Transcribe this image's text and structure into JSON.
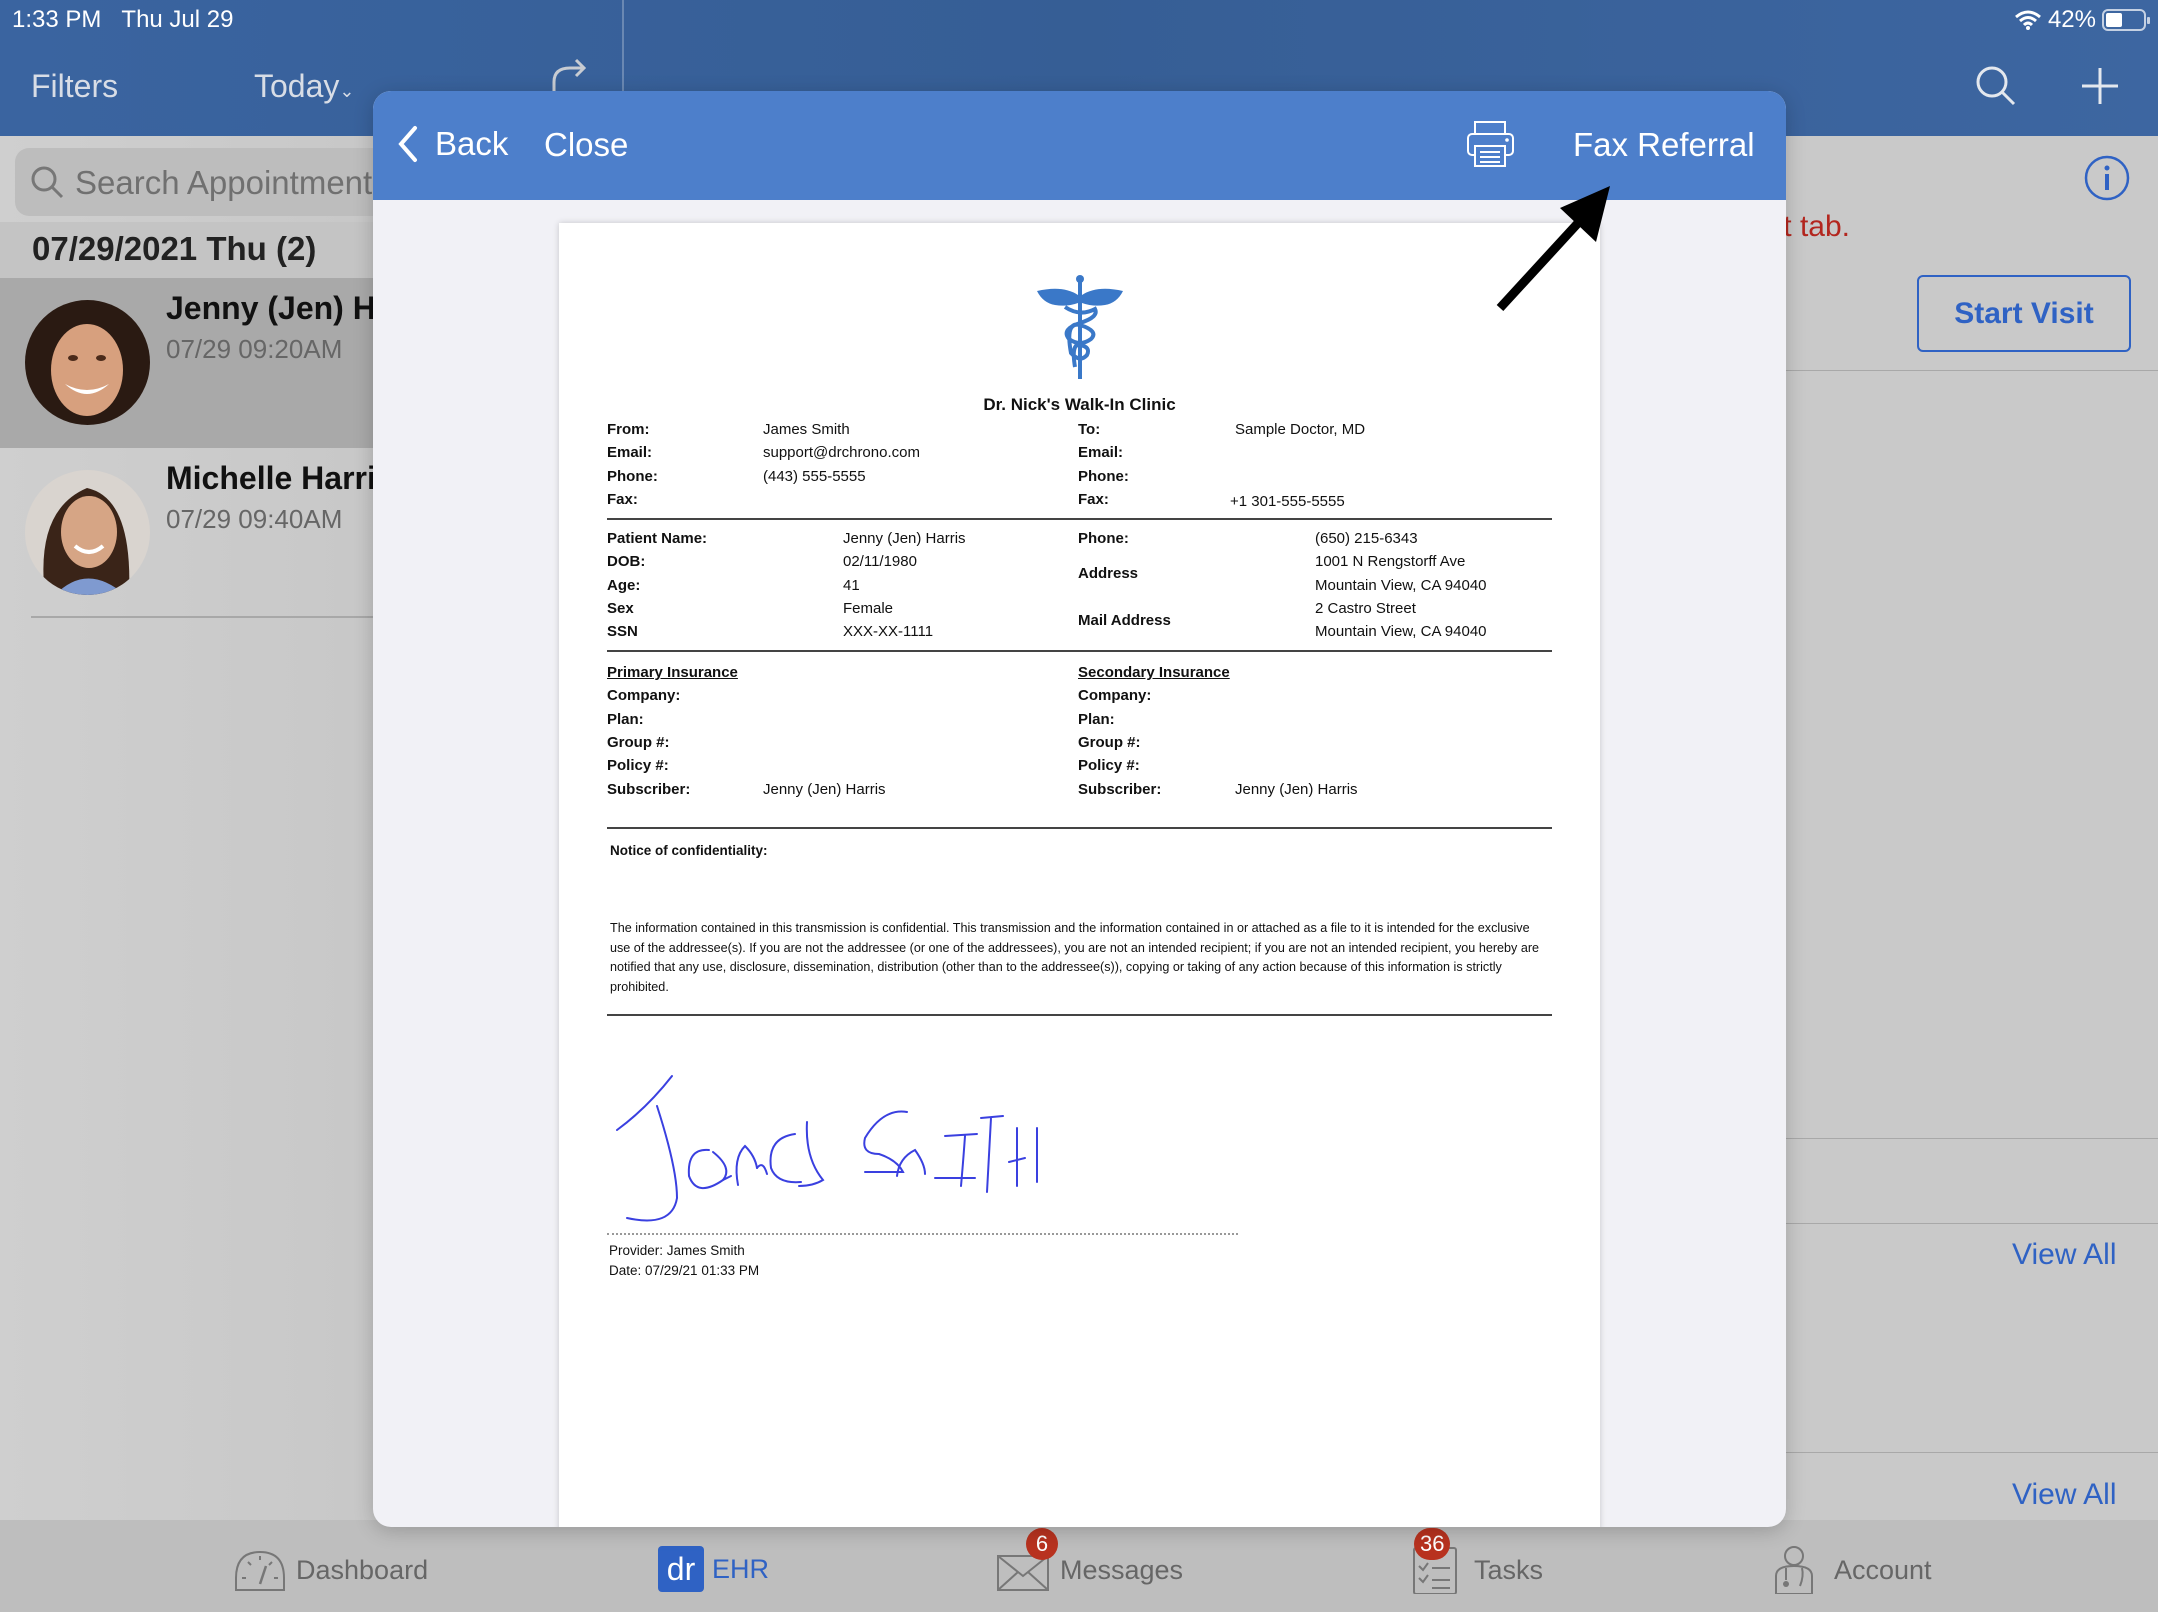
{
  "status_bar": {
    "time": "1:33 PM",
    "date": "Thu Jul 29",
    "battery_percent": "42%",
    "battery_level": 0.42,
    "wifi_icon": "wifi-icon"
  },
  "nav": {
    "filters_label": "Filters",
    "today_label": "Today",
    "today_chevron": "⌄",
    "refresh_icon": "refresh-icon",
    "search_icon": "search-icon",
    "add_icon": "plus-icon"
  },
  "sidebar": {
    "search_placeholder": "Search Appointments",
    "date_header": "07/29/2021 Thu (2)",
    "appointments": [
      {
        "name": "Jenny (Jen) Harris",
        "time": "07/29 09:20AM",
        "selected": true
      },
      {
        "name": "Michelle Harris",
        "time": "07/29 09:40AM",
        "selected": false
      }
    ]
  },
  "right_panel": {
    "info_icon": "info-icon",
    "warning_text": "t tab.",
    "start_visit_label": "Start Visit",
    "view_all_labels": [
      "View All",
      "View All"
    ]
  },
  "modal": {
    "back_label": "Back",
    "close_label": "Close",
    "print_icon": "printer-icon",
    "fax_label": "Fax Referral",
    "accent_color": "#4d7fcb"
  },
  "document": {
    "clinic_name": "Dr. Nick's Walk-In Clinic",
    "from": {
      "labels": [
        "From:",
        "Email:",
        "Phone:",
        "Fax:"
      ],
      "values": [
        "James Smith",
        "support@drchrono.com",
        "(443) 555-5555",
        ""
      ]
    },
    "to": {
      "labels": [
        "To:",
        "Email:",
        "Phone:",
        "Fax:"
      ],
      "values": [
        "Sample Doctor, MD",
        "",
        "",
        "+1 301-555-5555"
      ]
    },
    "patient": {
      "labels": [
        "Patient Name:",
        "DOB:",
        "Age:",
        "Sex",
        "SSN"
      ],
      "values": [
        "Jenny (Jen) Harris",
        "02/11/1980",
        "41",
        "Female",
        "XXX-XX-1111"
      ],
      "phone_label": "Phone:",
      "phone": "(650) 215-6343",
      "address_label": "Address",
      "address_lines": [
        "1001 N Rengstorff Ave",
        "Mountain View, CA 94040"
      ],
      "mail_address_label": "Mail Address",
      "mail_address_lines": [
        "2 Castro Street",
        "Mountain View, CA 94040"
      ]
    },
    "primary_insurance": {
      "title": "Primary Insurance",
      "labels": [
        "Company:",
        "Plan:",
        "Group #:",
        "Policy #:",
        "Subscriber:"
      ],
      "subscriber": "Jenny (Jen) Harris"
    },
    "secondary_insurance": {
      "title": "Secondary Insurance",
      "labels": [
        "Company:",
        "Plan:",
        "Group #:",
        "Policy #:",
        "Subscriber:"
      ],
      "subscriber": "Jenny (Jen) Harris"
    },
    "notice_title": "Notice of confidentiality:",
    "notice_text": "The information contained in this transmission is confidential. This transmission and the information contained in or attached as a file to it is intended for the exclusive use of the addressee(s). If you are not the addressee (or one of the addressees), you are not an intended recipient; if you are not an intended recipient, you hereby are notified that any use, disclosure, dissemination, distribution (other than to the addressee(s)), copying or taking of any action because of this information is strictly prohibited.",
    "signature_text": "James Smith",
    "provider_line": "Provider: James Smith",
    "date_line": "Date: 07/29/21 01:33 PM"
  },
  "tabbar": {
    "tabs": [
      {
        "label": "Dashboard",
        "icon": "dashboard-gauge-icon",
        "active": false,
        "badge": ""
      },
      {
        "label": "EHR",
        "icon": "dr-logo-icon",
        "icon_text": "dr",
        "active": true,
        "badge": ""
      },
      {
        "label": "Messages",
        "icon": "envelope-icon",
        "active": false,
        "badge": "6"
      },
      {
        "label": "Tasks",
        "icon": "checklist-icon",
        "active": false,
        "badge": "36"
      },
      {
        "label": "Account",
        "icon": "doctor-account-icon",
        "active": false,
        "badge": ""
      }
    ]
  }
}
